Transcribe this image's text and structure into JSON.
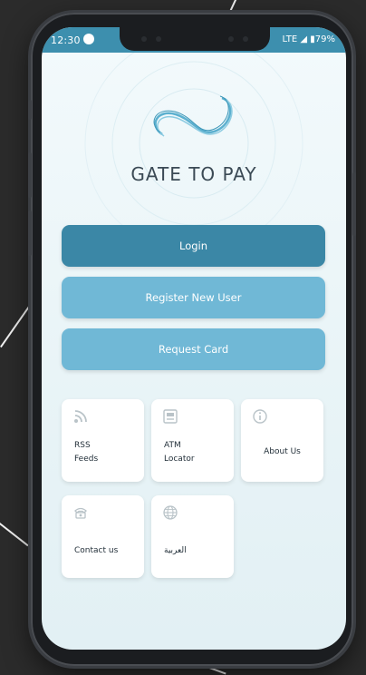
{
  "status_bar": {
    "time": "12:30",
    "network": "LTE",
    "battery": "79%"
  },
  "app": {
    "brand": "GATE TO PAY"
  },
  "buttons": {
    "login": "Login",
    "register": "Register New User",
    "request_card": "Request Card"
  },
  "tiles": [
    {
      "label": "RSS\nFeeds",
      "icon": "rss-icon"
    },
    {
      "label": "ATM\nLocator",
      "icon": "atm-icon"
    },
    {
      "label": "About Us",
      "icon": "info-icon"
    },
    {
      "label": "Contact us",
      "icon": "phone-icon"
    },
    {
      "label": "العربية",
      "icon": "globe-icon"
    }
  ],
  "colors": {
    "primary": "#3b87a6",
    "secondary": "#70b8d6",
    "status_bar": "#3d8fae",
    "background": "#2b2b2b"
  }
}
